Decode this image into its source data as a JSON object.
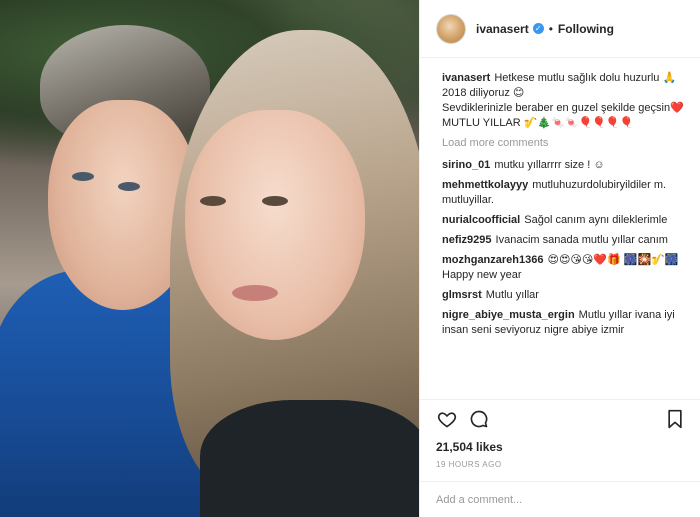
{
  "header": {
    "username": "ivanasert",
    "separator": "•",
    "follow_status": "Following"
  },
  "caption": {
    "user": "ivanasert",
    "lines": [
      "Hetkese mutlu sağlık dolu huzurlu 🙏 2018 diliyoruz 😊",
      "Sevdiklerinizle beraber en guzel şekilde geçsin❤️",
      "MUTLU YILLAR 🎷🎄🍬🍬🎈🎈🎈🎈"
    ]
  },
  "load_more": "Load more comments",
  "comments": [
    {
      "user": "sirino_01",
      "text": "mutku yıllarrrr size ! ☺"
    },
    {
      "user": "mehmettkolayyy",
      "text": "mutluhuzurdolubiryildiler m. mutluyillar."
    },
    {
      "user": "nurialcoofficial",
      "text": "Sağol canım aynı dileklerimle"
    },
    {
      "user": "nefiz9295",
      "text": "Ivanacim sanada mutlu yıllar canım"
    },
    {
      "user": "mozhganzareh1366",
      "text": "😍😍😘😘❤️🎁 🎆🎇🎷🎆Happy new year"
    },
    {
      "user": "glmsrst",
      "text": "Mutlu yıllar"
    },
    {
      "user": "nigre_abiye_musta_ergin",
      "text": "Mutlu yıllar ivana iyi insan seni seviyoruz nigre abiye izmir"
    }
  ],
  "icons": {
    "like": "heart-icon",
    "comment": "comment-icon",
    "save": "bookmark-icon"
  },
  "likes": "21,504 likes",
  "timestamp": "19 HOURS AGO",
  "add_comment_placeholder": "Add a comment...",
  "colors": {
    "verified": "#3897f0",
    "muted": "#999999",
    "text": "#262626"
  }
}
